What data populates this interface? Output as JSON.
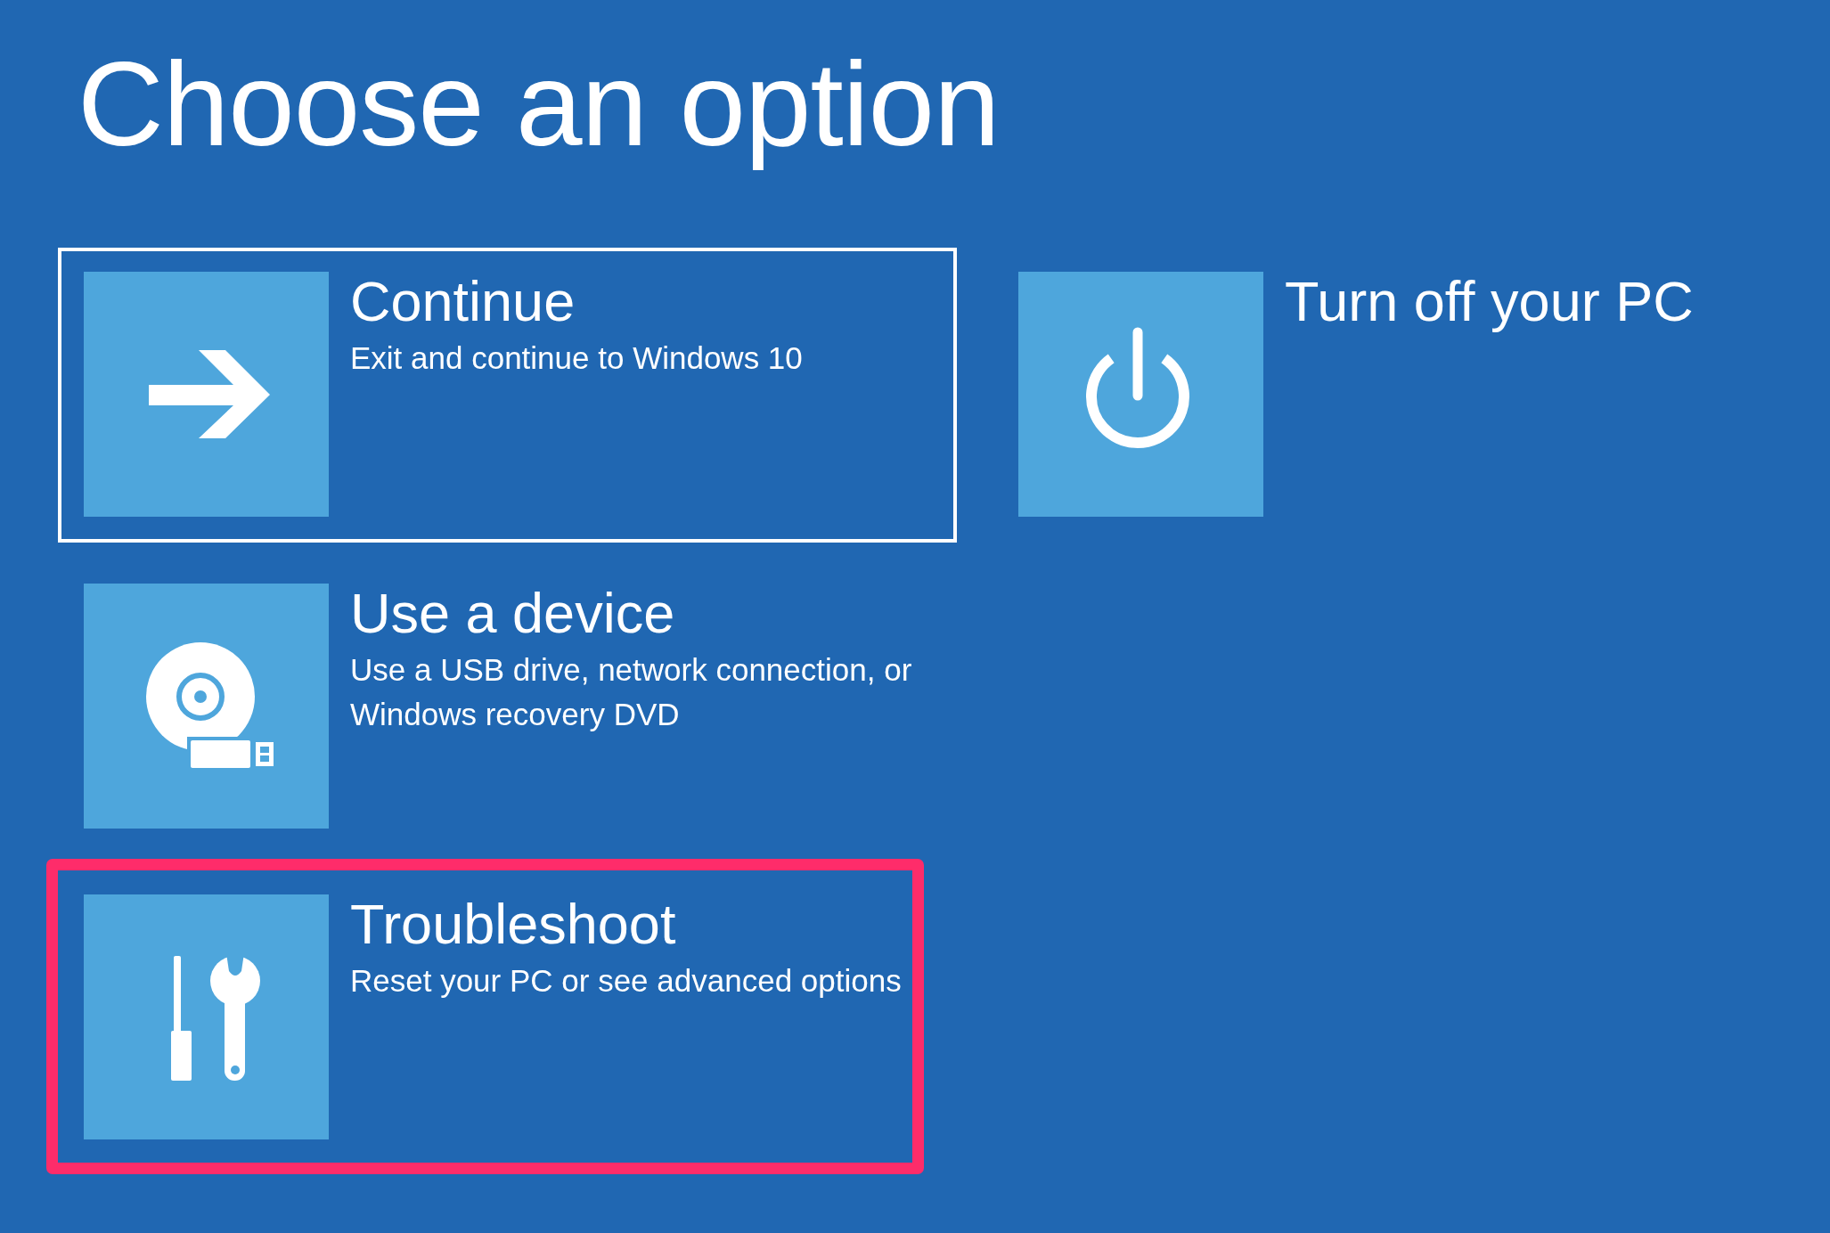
{
  "title": "Choose an option",
  "options": [
    {
      "kind": "continue",
      "title": "Continue",
      "description": "Exit and continue to Windows 10",
      "focused": true,
      "highlighted": false
    },
    {
      "kind": "device",
      "title": "Use a device",
      "description": "Use a USB drive, network connection, or Windows recovery DVD",
      "focused": false,
      "highlighted": false
    },
    {
      "kind": "troubleshoot",
      "title": "Troubleshoot",
      "description": "Reset your PC or see advanced options",
      "focused": false,
      "highlighted": true
    },
    {
      "kind": "power",
      "title": "Turn off your PC",
      "focused": false,
      "highlighted": false
    }
  ]
}
